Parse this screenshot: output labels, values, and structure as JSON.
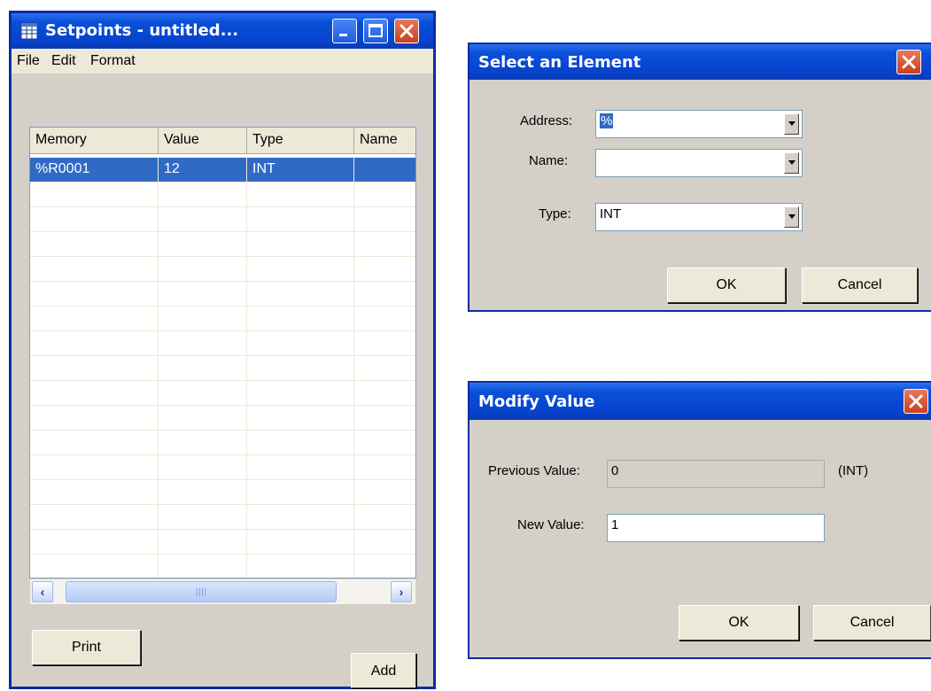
{
  "setpoints": {
    "title": "Setpoints - untitled...",
    "icon": "spreadsheet-icon",
    "menu": [
      "File",
      "Edit",
      "Format"
    ],
    "columns": [
      "Memory",
      "Value",
      "Type",
      "Name"
    ],
    "rows": [
      {
        "memory": "%R0001",
        "value": "12",
        "type": "INT",
        "name": ""
      }
    ],
    "print_label": "Print",
    "add_label": "Add",
    "colors": {
      "title_blue": "#0a4fd8",
      "selection": "#316ac5",
      "face": "#d4d0c8"
    }
  },
  "select_element": {
    "title": "Select an Element",
    "address_label": "Address:",
    "address_value": "%",
    "name_label": "Name:",
    "name_value": "",
    "type_label": "Type:",
    "type_value": "INT",
    "ok_label": "OK",
    "cancel_label": "Cancel"
  },
  "modify_value": {
    "title": "Modify Value",
    "previous_label": "Previous Value:",
    "previous_value": "0",
    "type_hint": "(INT)",
    "new_label": "New Value:",
    "new_value": "1",
    "ok_label": "OK",
    "cancel_label": "Cancel"
  }
}
